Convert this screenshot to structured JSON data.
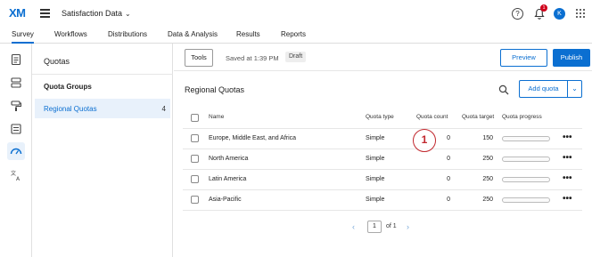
{
  "header": {
    "logo_text": "XM",
    "project_title": "Satisfaction Data",
    "notification_count": "1",
    "avatar_initial": "K",
    "accent": "#0b6fd1"
  },
  "nav": {
    "tabs": [
      {
        "label": "Survey",
        "active": true
      },
      {
        "label": "Workflows"
      },
      {
        "label": "Distributions"
      },
      {
        "label": "Data & Analysis"
      },
      {
        "label": "Results"
      },
      {
        "label": "Reports"
      }
    ]
  },
  "rail": {
    "icons": [
      "survey-flow-icon",
      "layout-icon",
      "paint-roller-icon",
      "survey-options-icon",
      "quotas-gauge-icon",
      "translate-icon"
    ]
  },
  "quotas_panel": {
    "title": "Quotas",
    "groups_label": "Quota Groups",
    "selected_group": {
      "label": "Regional Quotas",
      "count": "4"
    }
  },
  "toolbar": {
    "tools_label": "Tools",
    "saved_text": "Saved at 1:39 PM",
    "status_badge": "Draft",
    "preview_label": "Preview",
    "publish_label": "Publish"
  },
  "main": {
    "section_title": "Regional Quotas",
    "add_quota_label": "Add quota",
    "columns": {
      "name": "Name",
      "type": "Quota type",
      "count": "Quota count",
      "target": "Quota target",
      "progress": "Quota progress"
    },
    "rows": [
      {
        "name": "Europe, Middle East, and Africa",
        "type": "Simple",
        "count": "0",
        "target": "150",
        "progress": 0
      },
      {
        "name": "North America",
        "type": "Simple",
        "count": "0",
        "target": "250",
        "progress": 0
      },
      {
        "name": "Latin America",
        "type": "Simple",
        "count": "0",
        "target": "250",
        "progress": 0
      },
      {
        "name": "Asia-Pacific",
        "type": "Simple",
        "count": "0",
        "target": "250",
        "progress": 0
      }
    ],
    "more_label": "•••"
  },
  "annotation": {
    "label": "1",
    "color": "#c1272d"
  },
  "pagination": {
    "current_page": "1",
    "of_text": "of 1"
  }
}
